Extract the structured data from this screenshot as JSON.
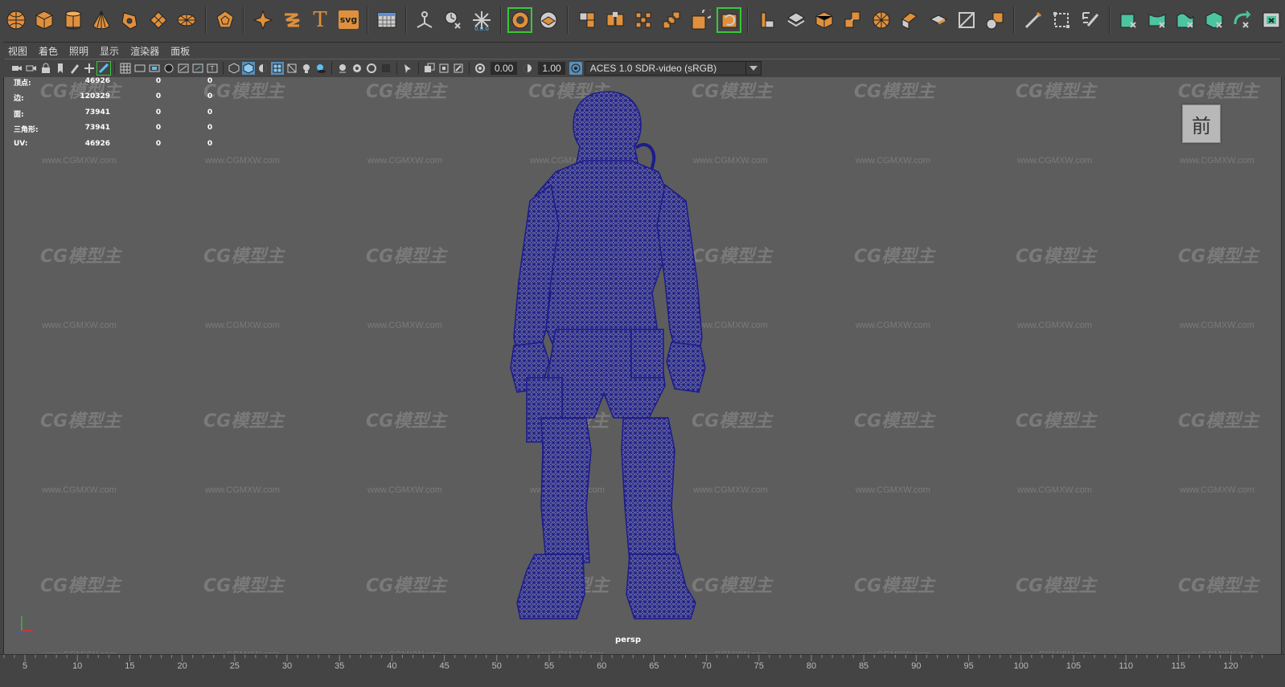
{
  "shelf": {
    "groups": [
      [
        "poly-sphere-icon",
        "poly-cube-icon",
        "poly-cylinder-icon",
        "poly-cone-icon",
        "poly-torus-icon",
        "poly-plane-icon",
        "poly-disc-icon"
      ],
      [
        "platonic-solid-icon"
      ],
      [
        "sweep-mesh-icon",
        "poly-helix-icon",
        "text-icon",
        "svg-icon"
      ],
      [
        "poly-grid-icon"
      ],
      [
        "combine-icon",
        "smooth-icon",
        "reduce-icon"
      ],
      [
        "mirror-icon",
        "bridge-icon",
        "fill-hole-icon",
        "boolean-icon",
        "target-weld-icon",
        "extrude-icon"
      ],
      [
        "bevel-icon",
        "bridge-edge-icon",
        "extrude-face-icon",
        "append-icon",
        "bevel-edge-icon",
        "wedge-icon",
        "crease-icon",
        "bevel-plus-icon"
      ],
      [
        "multi-cut-icon",
        "connect-icon",
        "edit-edge-flow-icon"
      ],
      [
        "uv-unfold-icon",
        "uv-layout-icon",
        "uv-planar-icon",
        "uv-cylindrical-icon",
        "uv-spherical-icon",
        "uv-camera-icon",
        "uv-automatic-icon"
      ]
    ],
    "svg_label": "svg",
    "text_glyph": "T"
  },
  "menubar": {
    "items": [
      "视图",
      "着色",
      "照明",
      "显示",
      "渲染器",
      "面板"
    ]
  },
  "view_toolbar": {
    "exposure": "0.00",
    "gamma": "1.00",
    "color_space": "ACES 1.0 SDR-video (sRGB)"
  },
  "hud": {
    "rows": [
      {
        "label": "顶点:",
        "v1": "46926",
        "v2": "0",
        "v3": "0"
      },
      {
        "label": "边:",
        "v1": "120329",
        "v2": "0",
        "v3": "0"
      },
      {
        "label": "面:",
        "v1": "73941",
        "v2": "0",
        "v3": "0"
      },
      {
        "label": "三角形:",
        "v1": "73941",
        "v2": "0",
        "v3": "0"
      },
      {
        "label": "UV:",
        "v1": "46926",
        "v2": "0",
        "v3": "0"
      }
    ]
  },
  "viewcube": {
    "label": "前"
  },
  "camera_label": "persp",
  "watermark": {
    "text": "CG模型主",
    "url": "www.CGMXW.com"
  },
  "timeline": {
    "ticks": [
      "5",
      "10",
      "15",
      "20",
      "25",
      "30",
      "35",
      "40",
      "45",
      "50",
      "55",
      "60",
      "65",
      "70",
      "75",
      "80",
      "85",
      "90",
      "95",
      "100",
      "105",
      "110",
      "115",
      "120"
    ]
  },
  "colors": {
    "wireframe": "#1c1c8c",
    "shelf_orange": "#e0903c",
    "shelf_teal": "#4cc4a0",
    "highlight_green": "#37c837"
  }
}
